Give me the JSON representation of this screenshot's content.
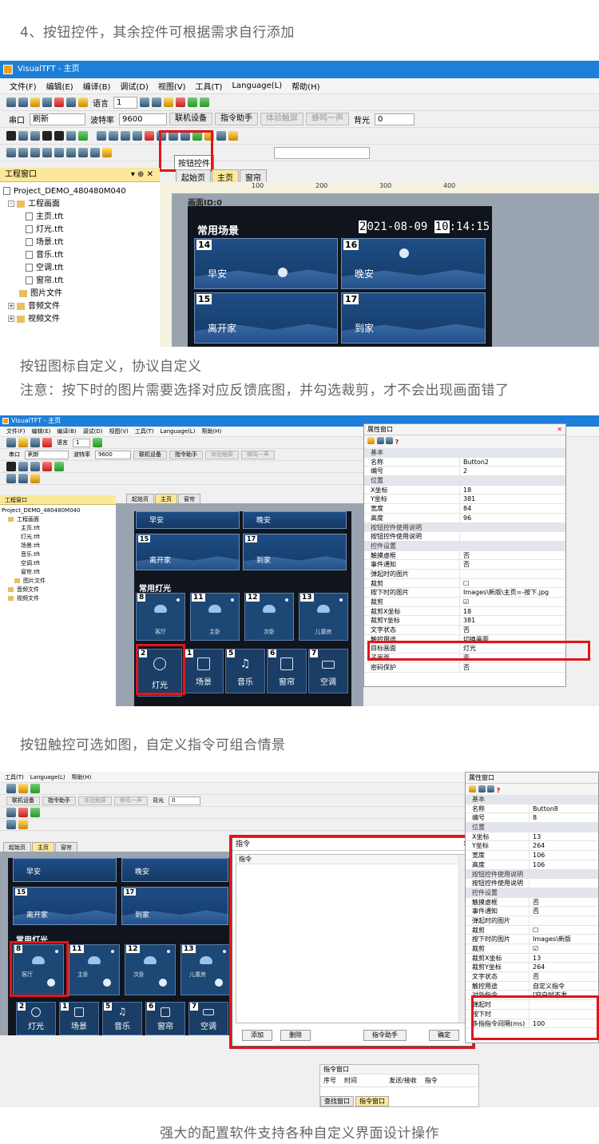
{
  "captions": {
    "c1": "4、按钮控件，其余控件可根据需求自行添加",
    "c2": "按钮图标自定义，协议自定义",
    "c3": "注意：按下时的图片需要选择对应反馈底图，并勾选裁剪，才不会出现画面错了",
    "c4": "按钮触控可选如图，自定义指令可组合情景",
    "c5": "强大的配置软件支持各种自定义界面设计操作"
  },
  "app": {
    "title": "VisualTFT - 主页",
    "menu": [
      "文件(F)",
      "编辑(E)",
      "编译(B)",
      "调试(D)",
      "视图(V)",
      "工具(T)",
      "Language(L)",
      "帮助(H)"
    ],
    "lang_label": "语言",
    "lang_value": "1",
    "port_label": "串口",
    "port_value": "刷新",
    "baud_label": "波特率",
    "baud_value": "9600",
    "connect": "联机设备",
    "cmd_helper": "指令助手",
    "touch_test": "体验触屏",
    "beep": "蜂鸣一声",
    "backlight_label": "背光",
    "backlight_value": "0",
    "tooltip": "按钮控件",
    "project_window": "工程窗口",
    "tree": {
      "project": "Project_DEMO_480480M040",
      "screens": "工程画面",
      "files": [
        "主页.tft",
        "灯光.tft",
        "场景.tft",
        "音乐.tft",
        "空调.tft",
        "窗帘.tft"
      ],
      "image_files": "图片文件",
      "audio_files": "音频文件",
      "video_files": "视频文件"
    },
    "tabs": [
      "起始页",
      "主页",
      "窗帘"
    ],
    "ruler_marks": [
      "100",
      "200",
      "300",
      "400"
    ],
    "screen_id": "画面ID:0"
  },
  "scene": {
    "title": "常用场景",
    "time_a": "2",
    "time_b": "021-08-09",
    "time_c": "10",
    "time_d": ":14:15",
    "tiles": [
      {
        "num": "14",
        "label": "早安"
      },
      {
        "num": "16",
        "label": "晚安"
      },
      {
        "num": "15",
        "label": "离开家"
      },
      {
        "num": "17",
        "label": "到家"
      }
    ]
  },
  "lights": {
    "title": "常用灯光",
    "tiles": [
      {
        "num": "8",
        "label": "客厅"
      },
      {
        "num": "11",
        "label": "主卧"
      },
      {
        "num": "12",
        "label": "次卧"
      },
      {
        "num": "13",
        "label": "儿童房"
      }
    ],
    "nav": [
      {
        "num": "2",
        "label": "灯光"
      },
      {
        "num": "1",
        "label": "场景"
      },
      {
        "num": "5",
        "label": "音乐"
      },
      {
        "num": "6",
        "label": "窗帘"
      },
      {
        "num": "7",
        "label": "空调"
      }
    ]
  },
  "props1": {
    "title": "属性窗口",
    "rows": [
      {
        "k": "基本",
        "v": "",
        "sec": true
      },
      {
        "k": "名称",
        "v": "Button2"
      },
      {
        "k": "编号",
        "v": "2"
      },
      {
        "k": "位置",
        "v": "",
        "sec": true
      },
      {
        "k": "X坐标",
        "v": "18"
      },
      {
        "k": "Y坐标",
        "v": "381"
      },
      {
        "k": "宽度",
        "v": "84"
      },
      {
        "k": "高度",
        "v": "96"
      },
      {
        "k": "按钮控件使用说明",
        "v": "",
        "sec": true
      },
      {
        "k": "按钮控件使用说明",
        "v": ""
      },
      {
        "k": "控件设置",
        "v": "",
        "sec": true
      },
      {
        "k": "触摸虚框",
        "v": "否"
      },
      {
        "k": "事件通知",
        "v": "否"
      },
      {
        "k": "弹起时的图片",
        "v": ""
      },
      {
        "k": "裁剪",
        "v": "☐"
      },
      {
        "k": "按下时的图片",
        "v": "Images\\新版\\主页=-按下.jpg"
      },
      {
        "k": "裁剪",
        "v": "☑"
      },
      {
        "k": "裁剪X坐标",
        "v": "18"
      },
      {
        "k": "裁剪Y坐标",
        "v": "381"
      },
      {
        "k": "文字状态",
        "v": "否"
      },
      {
        "k": "触控用途",
        "v": "切换画面"
      },
      {
        "k": "目标画面",
        "v": "灯光"
      },
      {
        "k": "子画面",
        "v": "否"
      },
      {
        "k": "密码保护",
        "v": "否"
      }
    ]
  },
  "props2": {
    "title": "属性窗口",
    "rows": [
      {
        "k": "基本",
        "v": "",
        "sec": true
      },
      {
        "k": "名称",
        "v": "Button8"
      },
      {
        "k": "编号",
        "v": "8"
      },
      {
        "k": "位置",
        "v": "",
        "sec": true
      },
      {
        "k": "X坐标",
        "v": "13"
      },
      {
        "k": "Y坐标",
        "v": "264"
      },
      {
        "k": "宽度",
        "v": "106"
      },
      {
        "k": "高度",
        "v": "106"
      },
      {
        "k": "按钮控件使用说明",
        "v": "",
        "sec": true
      },
      {
        "k": "按钮控件使用说明",
        "v": ""
      },
      {
        "k": "控件设置",
        "v": "",
        "sec": true
      },
      {
        "k": "触摸虚框",
        "v": "否"
      },
      {
        "k": "事件通知",
        "v": "否"
      },
      {
        "k": "弹起时的图片",
        "v": ""
      },
      {
        "k": "裁剪",
        "v": "☐"
      },
      {
        "k": "按下时的图片",
        "v": "Images\\新版"
      },
      {
        "k": "裁剪",
        "v": "☑"
      },
      {
        "k": "裁剪X坐标",
        "v": "13"
      },
      {
        "k": "裁剪Y坐标",
        "v": "264"
      },
      {
        "k": "文字状态",
        "v": "否"
      },
      {
        "k": "触控用途",
        "v": "自定义指令"
      },
      {
        "k": "对外指令",
        "v": "[空白时不发"
      },
      {
        "k": "弹起时",
        "v": ""
      },
      {
        "k": "按下时",
        "v": ""
      },
      {
        "k": "多指指令间隔(ms)",
        "v": "100"
      }
    ]
  },
  "cmd_dialog": {
    "title": "指令",
    "col": "指令",
    "add": "添加",
    "del": "删除",
    "helper": "指令助手",
    "ok": "确定"
  },
  "cmd_window": {
    "title": "指令窗口",
    "cols": [
      "序号",
      "时间",
      "发送/接收",
      "指令"
    ],
    "tabs": [
      "查找窗口",
      "指令窗口"
    ]
  }
}
